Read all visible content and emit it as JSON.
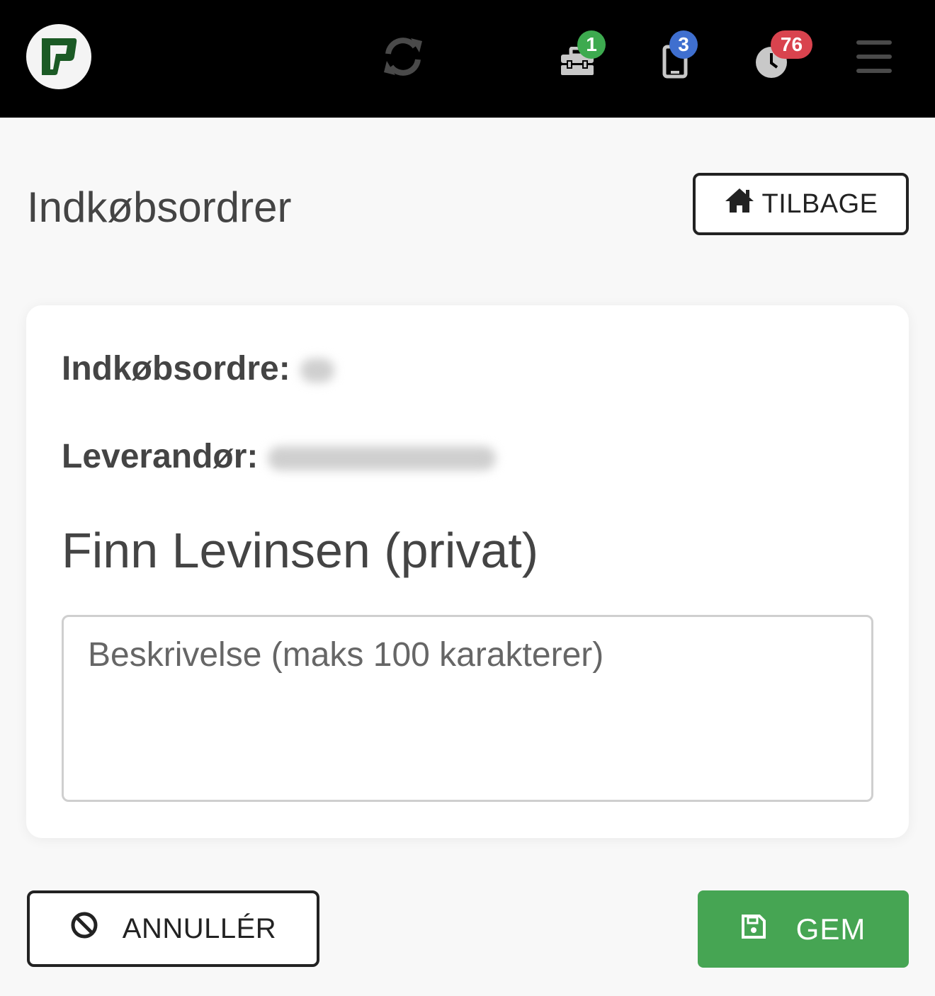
{
  "header": {
    "logo_icon": "app-logo",
    "sync_icon": "sync-icon",
    "tools_icon": "toolbox-icon",
    "tools_badge": "1",
    "phone_icon": "phone-icon",
    "phone_badge": "3",
    "clock_icon": "clock-icon",
    "clock_badge": "76",
    "menu_icon": "hamburger-menu-icon",
    "colors": {
      "green": "#3daa4f",
      "blue": "#3f6fcf",
      "red": "#d9434e"
    }
  },
  "page": {
    "title": "Indkøbsordrer",
    "back_label": "TILBAGE",
    "back_icon": "home-icon"
  },
  "order": {
    "number_label": "Indkøbsordre:",
    "supplier_label": "Leverandør:",
    "customer_name": "Finn Levinsen (privat)",
    "description_placeholder": "Beskrivelse (maks 100 karakterer)"
  },
  "actions": {
    "cancel_label": "ANNULLÉR",
    "cancel_icon": "ban-icon",
    "save_label": "GEM",
    "save_icon": "floppy-disk-icon",
    "save_color": "#46a553"
  }
}
